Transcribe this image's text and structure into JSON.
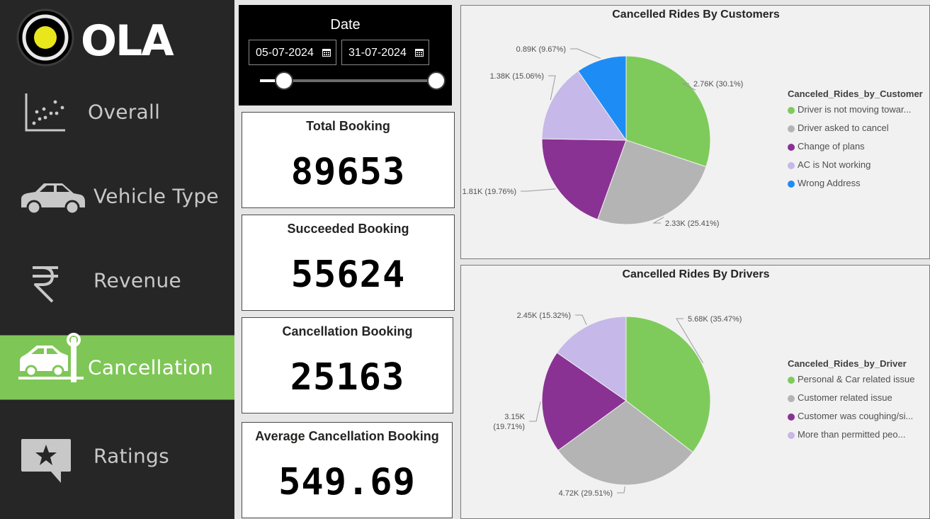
{
  "app": {
    "brand": "OLA"
  },
  "sidebar": {
    "items": [
      {
        "label": "Overall",
        "icon": "scatter-plot-icon",
        "active": false
      },
      {
        "label": "Vehicle Type",
        "icon": "car-icon",
        "active": false
      },
      {
        "label": "Revenue",
        "icon": "rupee-icon",
        "active": false
      },
      {
        "label": "Cancellation",
        "icon": "car-crash-icon",
        "active": true
      },
      {
        "label": "Ratings",
        "icon": "star-message-icon",
        "active": false
      }
    ],
    "active_color": "#7ec656"
  },
  "date_filter": {
    "title": "Date",
    "start": "05-07-2024",
    "end": "31-07-2024"
  },
  "kpis": [
    {
      "title": "Total Booking",
      "value": "89653"
    },
    {
      "title": "Succeeded Booking",
      "value": "55624"
    },
    {
      "title": "Cancellation Booking",
      "value": "25163"
    },
    {
      "title": "Average Cancellation Booking",
      "value": "549.69"
    }
  ],
  "chart_data": [
    {
      "type": "pie",
      "title": "Cancelled Rides By Customers",
      "legend_title": "Canceled_Rides_by_Customer",
      "legend_placement": "right",
      "slices": [
        {
          "name": "Driver is not moving towar...",
          "value": 2.76,
          "label": "2.76K (30.1%)",
          "percent": 30.1,
          "color": "#7ecb5c"
        },
        {
          "name": "Driver asked to cancel",
          "value": 2.33,
          "label": "2.33K (25.41%)",
          "percent": 25.41,
          "color": "#b4b4b4"
        },
        {
          "name": "Change of plans",
          "value": 1.81,
          "label": "1.81K (19.76%)",
          "percent": 19.76,
          "color": "#8a3293"
        },
        {
          "name": "AC is Not working",
          "value": 1.38,
          "label": "1.38K (15.06%)",
          "percent": 15.06,
          "color": "#c6b8e8"
        },
        {
          "name": "Wrong Address",
          "value": 0.89,
          "label": "0.89K (9.67%)",
          "percent": 9.67,
          "color": "#1e8cf5"
        }
      ]
    },
    {
      "type": "pie",
      "title": "Cancelled Rides By Drivers",
      "legend_title": "Canceled_Rides_by_Driver",
      "legend_placement": "right",
      "slices": [
        {
          "name": "Personal & Car related issue",
          "value": 5.68,
          "label": "5.68K (35.47%)",
          "percent": 35.47,
          "color": "#7ecb5c"
        },
        {
          "name": "Customer related issue",
          "value": 4.72,
          "label": "4.72K (29.51%)",
          "percent": 29.51,
          "color": "#b4b4b4"
        },
        {
          "name": "Customer was coughing/si...",
          "value": 3.15,
          "label": "3.15K (19.71%)",
          "label_lines": [
            "3.15K",
            "(19.71%)"
          ],
          "percent": 19.71,
          "color": "#8a3293"
        },
        {
          "name": "More than permitted peo...",
          "value": 2.45,
          "label": "2.45K (15.32%)",
          "percent": 15.32,
          "color": "#c6b8e8"
        }
      ]
    }
  ]
}
